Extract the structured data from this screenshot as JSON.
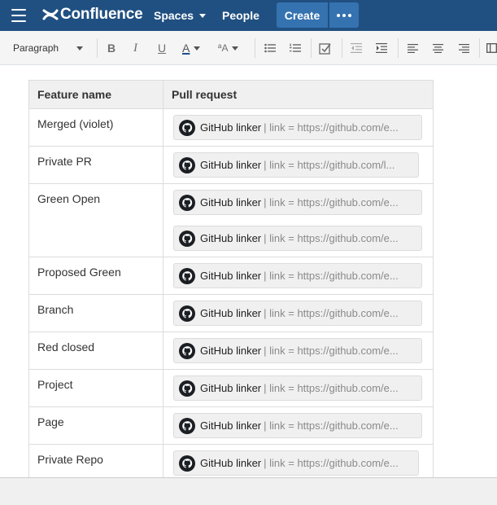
{
  "nav": {
    "logo_text": "Confluence",
    "spaces_label": "Spaces",
    "people_label": "People",
    "create_label": "Create"
  },
  "toolbar": {
    "paragraph_label": "Paragraph",
    "bold": "B",
    "italic": "I",
    "underline": "U",
    "text_color": "A",
    "text_color_accent": "#1f4e8c",
    "more_formatting": "ªA"
  },
  "table": {
    "headers": [
      "Feature name",
      "Pull request"
    ],
    "rows": [
      {
        "feature": "Merged (violet)",
        "macros": [
          {
            "name": "GitHub linker",
            "param": "| link = https://github.com/e..."
          }
        ]
      },
      {
        "feature": "Private PR",
        "macros": [
          {
            "name": "GitHub linker",
            "param": "| link = https://github.com/l..."
          }
        ]
      },
      {
        "feature": "Green Open",
        "macros": [
          {
            "name": "GitHub linker",
            "param": "| link = https://github.com/e..."
          },
          {
            "name": "GitHub linker",
            "param": "| link = https://github.com/e..."
          }
        ]
      },
      {
        "feature": "Proposed Green",
        "macros": [
          {
            "name": "GitHub linker",
            "param": "| link = https://github.com/e..."
          }
        ]
      },
      {
        "feature": "Branch",
        "macros": [
          {
            "name": "GitHub linker",
            "param": "| link = https://github.com/e..."
          }
        ]
      },
      {
        "feature": "Red closed",
        "macros": [
          {
            "name": "GitHub linker",
            "param": "| link = https://github.com/e..."
          }
        ]
      },
      {
        "feature": "Project",
        "macros": [
          {
            "name": "GitHub linker",
            "param": "| link = https://github.com/e..."
          }
        ]
      },
      {
        "feature": "Page",
        "macros": [
          {
            "name": "GitHub linker",
            "param": "| link = https://github.com/e..."
          }
        ]
      },
      {
        "feature": "Private Repo",
        "macros": [
          {
            "name": "GitHub linker",
            "param": "| link = https://github.com/e..."
          }
        ]
      }
    ]
  },
  "colors": {
    "nav_background": "#205081",
    "create_button": "#3572b0"
  }
}
